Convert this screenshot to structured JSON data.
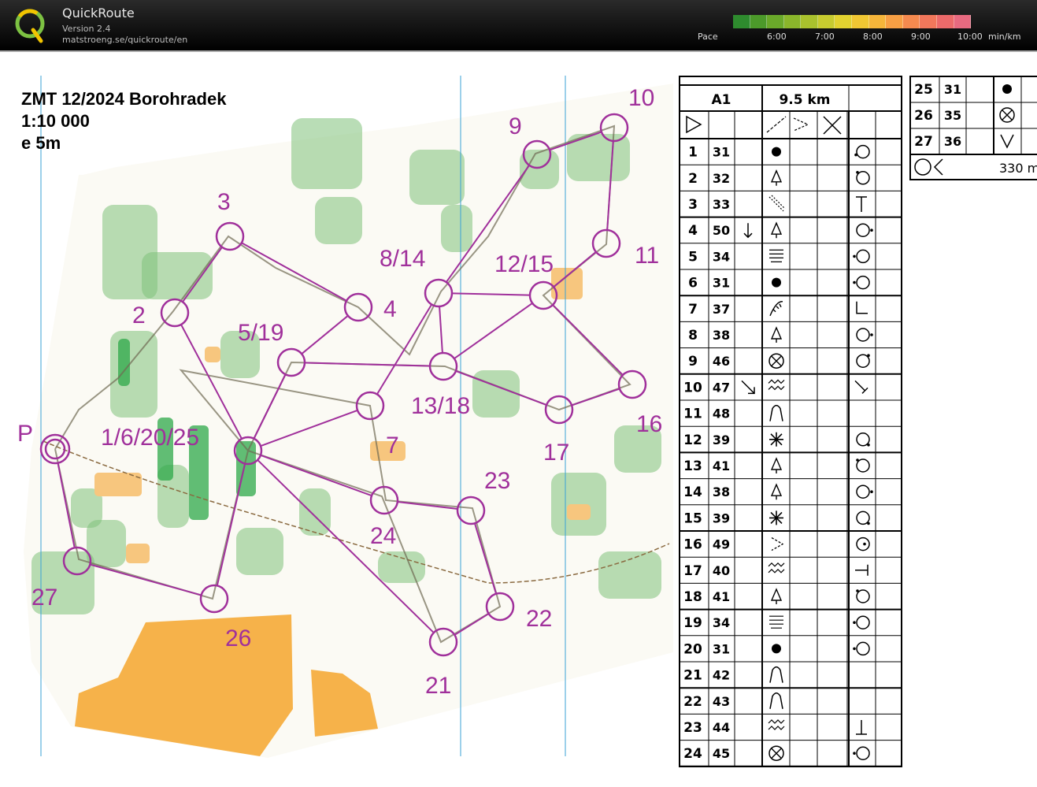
{
  "app": {
    "name": "QuickRoute",
    "version": "Version 2.4",
    "url": "matstroeng.se/quickroute/en"
  },
  "pace_legend": {
    "label": "Pace",
    "ticks": [
      "6:00",
      "7:00",
      "8:00",
      "9:00",
      "10:00"
    ],
    "unit": "min/km",
    "colors": [
      "#2e8b2e",
      "#4c9a2a",
      "#6aa92a",
      "#8ab62b",
      "#a9c12d",
      "#c7cb2f",
      "#e2d230",
      "#f0c733",
      "#f5b53a",
      "#f79f44",
      "#f58a4f",
      "#f1775b",
      "#ec6a6a",
      "#e86a80"
    ]
  },
  "map": {
    "title": [
      "ZMT 12/2024 Borohradek",
      "1:10 000",
      "e 5m"
    ],
    "controls": [
      {
        "label": "P"
      },
      {
        "label": "1/6/20/25"
      },
      {
        "label": "2"
      },
      {
        "label": "3"
      },
      {
        "label": "4"
      },
      {
        "label": "5/19"
      },
      {
        "label": "7"
      },
      {
        "label": "8/14"
      },
      {
        "label": "9"
      },
      {
        "label": "10"
      },
      {
        "label": "11"
      },
      {
        "label": "12/15"
      },
      {
        "label": "13/18"
      },
      {
        "label": "16"
      },
      {
        "label": "17"
      },
      {
        "label": "21"
      },
      {
        "label": "22"
      },
      {
        "label": "23"
      },
      {
        "label": "24"
      },
      {
        "label": "26"
      },
      {
        "label": "27"
      }
    ],
    "colors": {
      "course": "#a0309b",
      "vegetation": "#7fc17a",
      "open": "#f6b24a",
      "route": "#6f6a52"
    }
  },
  "description": {
    "class": "A1",
    "length": "9.5 km",
    "finish_distance": "330 m",
    "rows": [
      {
        "n": "1",
        "code": "31",
        "feature": "dot",
        "detail": "lower-left"
      },
      {
        "n": "2",
        "code": "32",
        "feature": "tree",
        "detail": "upper-left"
      },
      {
        "n": "3",
        "code": "33",
        "feature": "ridge",
        "detail": "T"
      },
      {
        "n": "4",
        "code": "50",
        "dir": "down",
        "feature": "tree",
        "detail": "right"
      },
      {
        "n": "5",
        "code": "34",
        "feature": "terrace",
        "detail": "left"
      },
      {
        "n": "6",
        "code": "31",
        "feature": "dot",
        "detail": "left"
      },
      {
        "n": "7",
        "code": "37",
        "feature": "cliff",
        "detail": "corner"
      },
      {
        "n": "8",
        "code": "38",
        "feature": "tree",
        "detail": "right"
      },
      {
        "n": "9",
        "code": "46",
        "feature": "cross-circle",
        "detail": "upper-right"
      },
      {
        "n": "10",
        "code": "47",
        "dir": "diag",
        "feature": "wall",
        "detail": "end"
      },
      {
        "n": "11",
        "code": "48",
        "feature": "knoll",
        "detail": ""
      },
      {
        "n": "12",
        "code": "39",
        "feature": "thicket",
        "detail": "lower-right"
      },
      {
        "n": "13",
        "code": "41",
        "feature": "tree",
        "detail": "upper-left"
      },
      {
        "n": "14",
        "code": "38",
        "feature": "tree",
        "detail": "right"
      },
      {
        "n": "15",
        "code": "39",
        "feature": "thicket",
        "detail": "lower-right"
      },
      {
        "n": "16",
        "code": "49",
        "feature": "gap",
        "detail": "center"
      },
      {
        "n": "17",
        "code": "40",
        "feature": "wall",
        "detail": "end-right"
      },
      {
        "n": "18",
        "code": "41",
        "feature": "tree",
        "detail": "upper-left"
      },
      {
        "n": "19",
        "code": "34",
        "feature": "terrace",
        "detail": "left"
      },
      {
        "n": "20",
        "code": "31",
        "feature": "dot",
        "detail": "left"
      },
      {
        "n": "21",
        "code": "42",
        "feature": "knoll",
        "detail": ""
      },
      {
        "n": "22",
        "code": "43",
        "feature": "knoll",
        "detail": ""
      },
      {
        "n": "23",
        "code": "44",
        "feature": "wall",
        "detail": "T-bottom"
      },
      {
        "n": "24",
        "code": "45",
        "feature": "cross-circle",
        "detail": "left"
      },
      {
        "n": "25",
        "code": "31",
        "feature": "dot",
        "detail": ""
      },
      {
        "n": "26",
        "code": "35",
        "feature": "cross-circle",
        "detail": ""
      },
      {
        "n": "27",
        "code": "36",
        "feature": "v",
        "detail": ""
      }
    ]
  }
}
